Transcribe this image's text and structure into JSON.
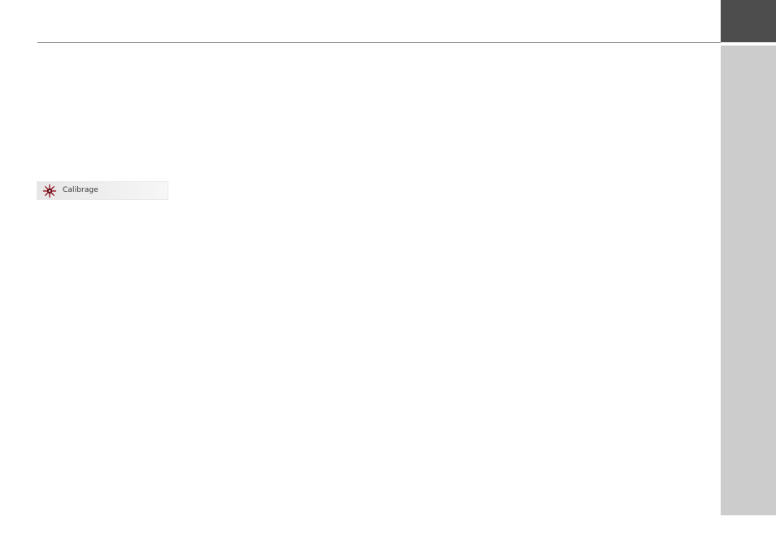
{
  "colors": {
    "header_rule": "#7f7f7f",
    "dark_tab": "#4d4d4d",
    "sidebar": "#cccccc",
    "strip_light": "#f7f7f7",
    "strip_dark": "#e6e6e6",
    "icon_accent": "#9b1c2a"
  },
  "menu_item": {
    "icon": "compass-calibration-icon",
    "label": "Calibrage"
  }
}
